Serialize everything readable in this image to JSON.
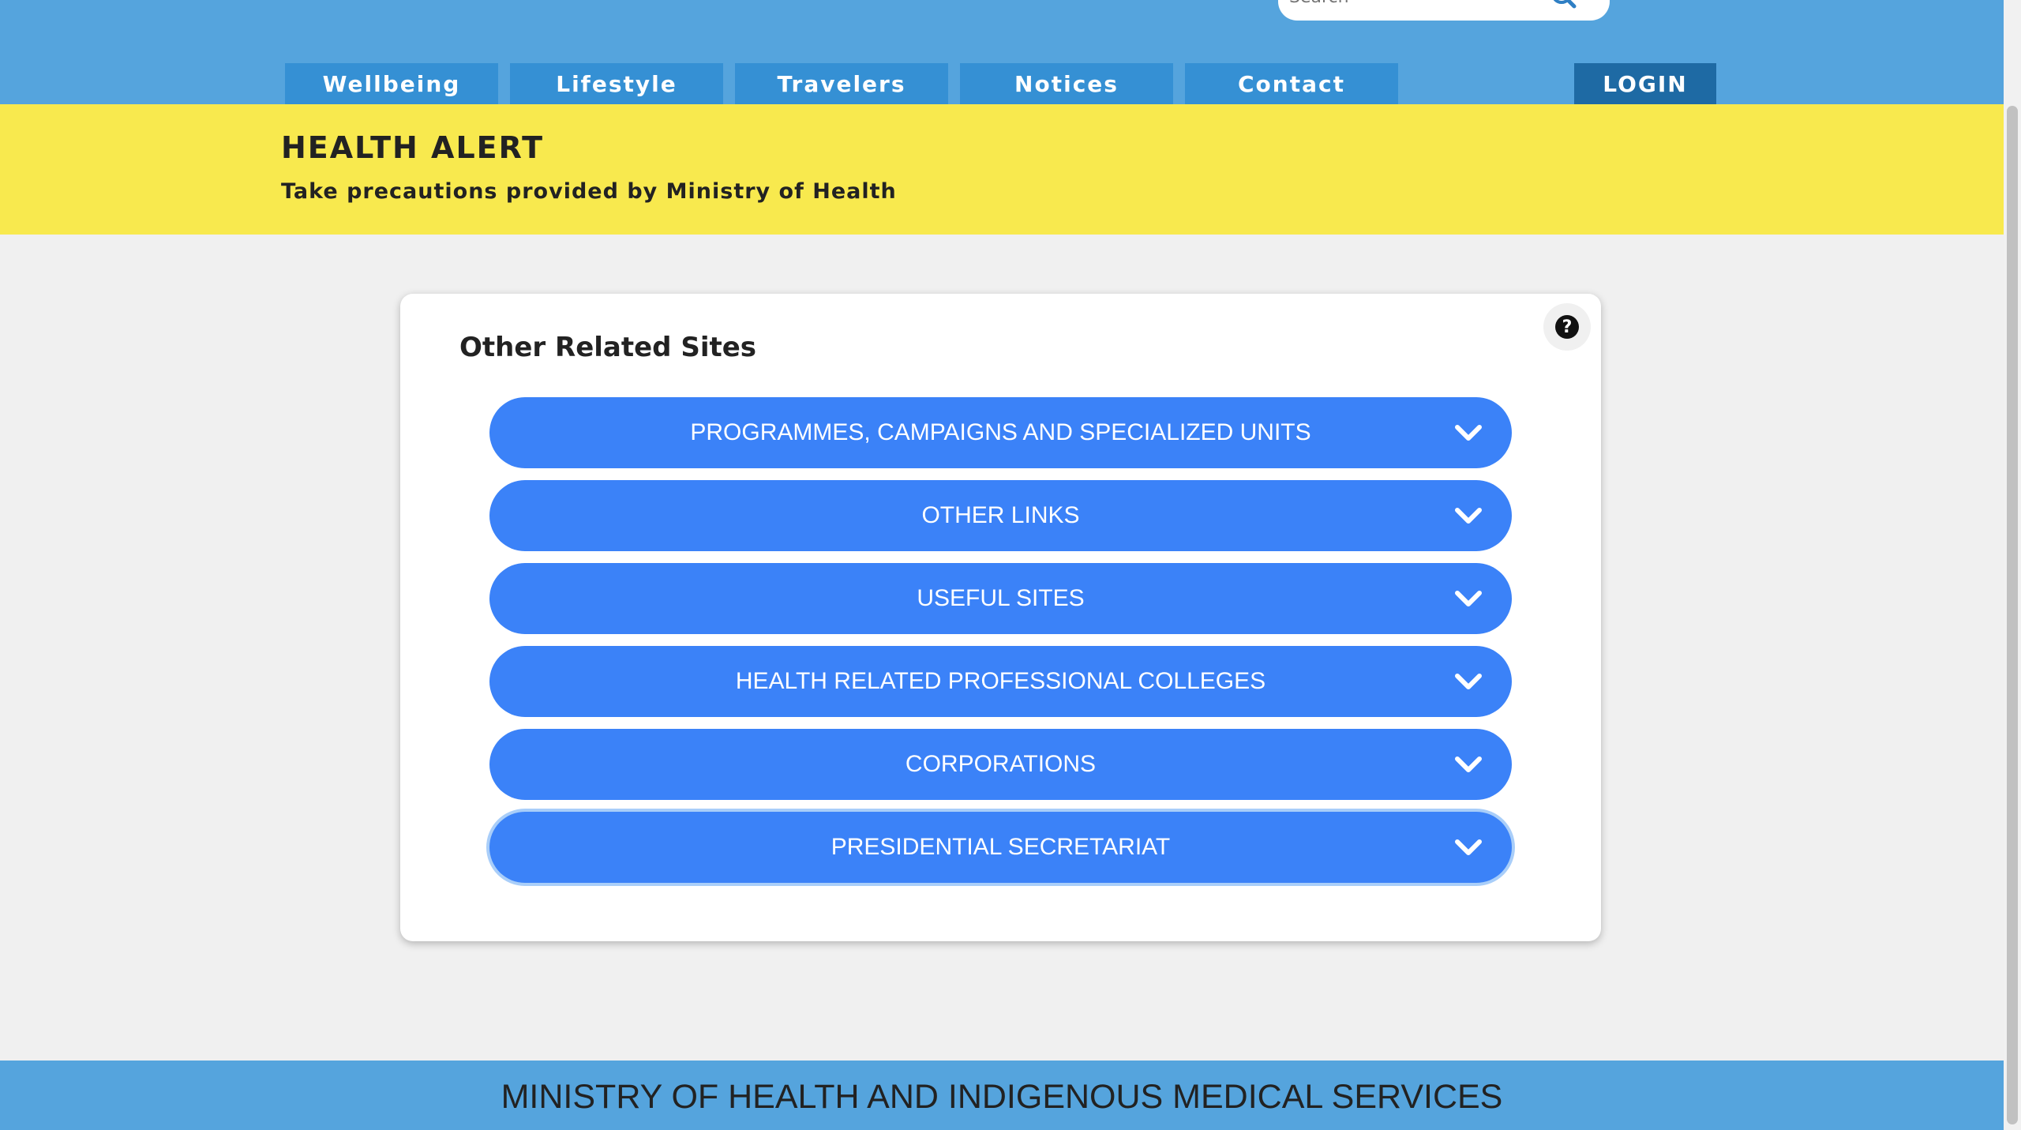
{
  "search": {
    "placeholder": "Search"
  },
  "nav": {
    "tabs": [
      {
        "label": "Wellbeing"
      },
      {
        "label": "Lifestyle"
      },
      {
        "label": "Travelers"
      },
      {
        "label": "Notices"
      },
      {
        "label": "Contact"
      }
    ],
    "login_label": "LOGIN"
  },
  "alert": {
    "title": "HEALTH ALERT",
    "subtitle": "Take precautions provided by Ministry of Health"
  },
  "card": {
    "title": "Other Related Sites",
    "help_icon": "?",
    "accordions": [
      {
        "label": "PROGRAMMES, CAMPAIGNS AND SPECIALIZED UNITS"
      },
      {
        "label": "OTHER LINKS"
      },
      {
        "label": "USEFUL SITES"
      },
      {
        "label": "HEALTH RELATED PROFESSIONAL COLLEGES"
      },
      {
        "label": "CORPORATIONS"
      },
      {
        "label": "PRESIDENTIAL SECRETARIAT"
      }
    ]
  },
  "footer": {
    "text": "MINISTRY OF HEALTH AND INDIGENOUS MEDICAL SERVICES"
  },
  "colors": {
    "header": "#55a4dd",
    "nav_tab": "#3590d4",
    "login": "#1e6aa4",
    "alert": "#f8e94e",
    "accordion": "#3b82f8",
    "background": "#f0f0f0"
  }
}
